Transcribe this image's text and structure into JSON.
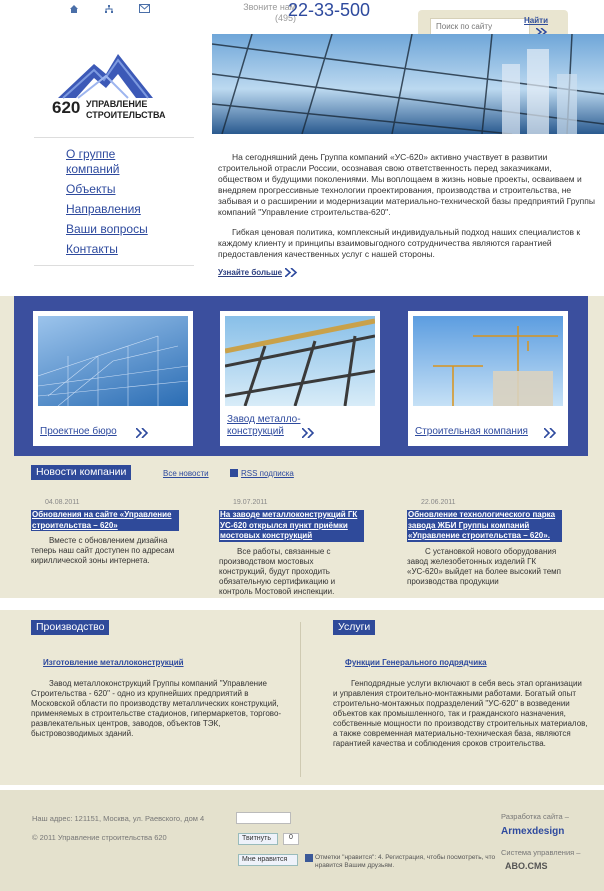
{
  "header": {
    "home_icon": "home-icon",
    "sitemap_icon": "sitemap-icon",
    "mail_icon": "mail-icon",
    "call_label": "Звоните нам",
    "call_code": "(495)",
    "phone": "22-33-500",
    "search_placeholder": "Поиск по сайту",
    "search_button": "Найти"
  },
  "logo": {
    "number": "620",
    "line1": "Управление",
    "line2": "строительства"
  },
  "menu": [
    "О группе компаний",
    "Объекты",
    "Направления",
    "Ваши вопросы",
    "Контакты"
  ],
  "intro": {
    "p1": "На сегодняшний день Группа компаний «УС-620» активно участвует в развитии строительной отрасли России, осознавая свою ответственность перед заказчиками, обществом и будущими поколениями. Мы воплощаем в жизнь новые проекты, осваиваем и внедряем прогрессивные технологии проектирования, производства и строительства, не забывая и о расширении и модернизации материально-технической базы предприятий Группы компаний \"Управление строительства-620\".",
    "p2": "Гибкая ценовая политика, комплексный индивидуальный подход наших специалистов к каждому клиенту и принципы взаимовыгодного сотрудничества являются гарантией предоставления качественных услуг с нашей стороны.",
    "more": "Узнайте больше"
  },
  "cards": [
    "Проектное бюро",
    "Завод металло-конструкций",
    "Строительная компания"
  ],
  "news": {
    "heading": "Новости компании",
    "all": "Все новости",
    "rss": "RSS подписка",
    "items": [
      {
        "date": "04.08.2011",
        "title": "Обновления на сайте «Управление строительства – 620»",
        "body": "Вместе с обновлением дизайна теперь наш сайт доступен по адресам кириллической зоны интернета."
      },
      {
        "date": "19.07.2011",
        "title": "На заводе металлоконструкций ГК УС-620 открылся пункт приёмки мостовых конструкций",
        "body": "Все работы, связанные с производством мостовых конструкций, будут проходить обязательную сертификацию и контроль Мостовой инспекции."
      },
      {
        "date": "22.06.2011",
        "title": "Обновление технологического парка завода ЖБИ Группы компаний «Управление строительства – 620».",
        "body": "С установкой нового оборудования завод железобетонных изделий ГК «УС-620» выйдет на более высокий темп производства продукции"
      }
    ]
  },
  "production": {
    "heading": "Производство",
    "item": "Изготовление металлоконструкций",
    "text": "Завод металлоконструкций Группы компаний \"Управление Строительства - 620\" - одно из крупнейших предприятий в Московской области по производству металлических конструкций, применяемых в строительстве стадионов, гипермаркетов, торгово-развлекательных центров, заводов, объектов ТЭК, быстровозводимых зданий."
  },
  "services": {
    "heading": "Услуги",
    "item": "Функции Генерального подрядчика",
    "text": "Генподрядные услуги включают в себя весь этап организации и управления строительно-монтажными работами. Богатый опыт строительно-монтажных подразделений \"УС-620\" в возведении объектов как промышленного, так и гражданского назначения, собственные мощности по производству строительных материалов, а также современная материально-техническая база, являются гарантией качества и соблюдения сроков строительства."
  },
  "footer": {
    "address": "Наш адрес: 121151, Москва, ул. Раевского, дом 4",
    "copyright": "© 2011 Управление строительства 620",
    "twitter": "Твитнуть",
    "twitter_count": "0",
    "like": "Мне нравится",
    "like_text": "Отметки \"нравится\": 4. Регистрация, чтобы посмотреть, что нравится Вашим друзьям.",
    "dev_label": "Разработка сайта –",
    "dev_name": "Armexdesign",
    "cms_label": "Система управления –",
    "cms_name": "ABO.CMS"
  }
}
